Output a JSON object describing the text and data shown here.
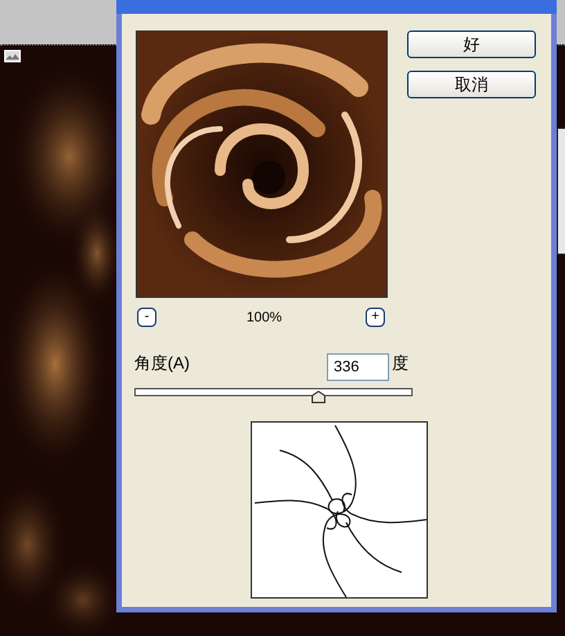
{
  "dialog": {
    "buttons": [
      {
        "label": "好"
      },
      {
        "label": "取消"
      }
    ],
    "preview": {
      "kind": "picture",
      "zoom_out": "-",
      "zoom": "100%",
      "zoom_in": "+"
    },
    "angle": {
      "label": "角度(A)",
      "value": "336",
      "unit": "度",
      "level": 0.67
    }
  }
}
